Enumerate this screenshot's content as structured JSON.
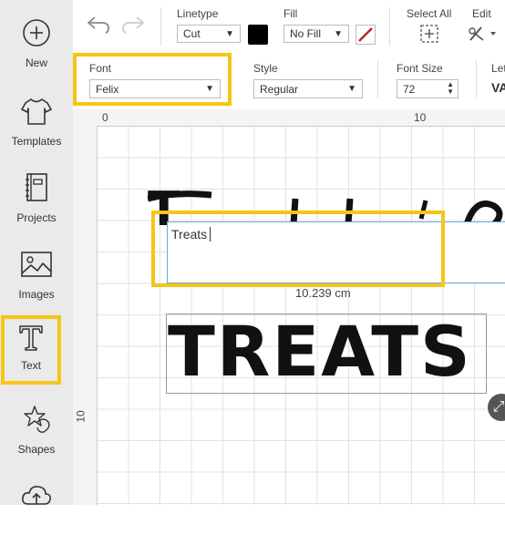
{
  "sidebar": {
    "items": [
      {
        "label": "New",
        "icon": "plus-circle-icon"
      },
      {
        "label": "Templates",
        "icon": "tshirt-icon"
      },
      {
        "label": "Projects",
        "icon": "notebook-icon"
      },
      {
        "label": "Images",
        "icon": "image-icon"
      },
      {
        "label": "Text",
        "icon": "text-t-icon",
        "selected": true
      },
      {
        "label": "Shapes",
        "icon": "shapes-icon"
      },
      {
        "label": "",
        "icon": "cloud-upload-icon"
      }
    ]
  },
  "toolbar": {
    "linetype_label": "Linetype",
    "linetype_value": "Cut",
    "fill_label": "Fill",
    "fill_value": "No Fill",
    "select_all_label": "Select All",
    "edit_label": "Edit"
  },
  "text_toolbar": {
    "font_label": "Font",
    "font_value": "Felix",
    "style_label": "Style",
    "style_value": "Regular",
    "font_size_label": "Font Size",
    "font_size_value": "72",
    "letter_label": "Let"
  },
  "canvas": {
    "ruler_top": [
      "0",
      "10"
    ],
    "ruler_left": [
      "10"
    ],
    "text_input_value": "Treats",
    "width_readout": "10.239 cm",
    "main_text": "TREATS",
    "partial_text": "T"
  },
  "colors": {
    "accent": "#f5c518",
    "selection": "#6aa7e0"
  }
}
